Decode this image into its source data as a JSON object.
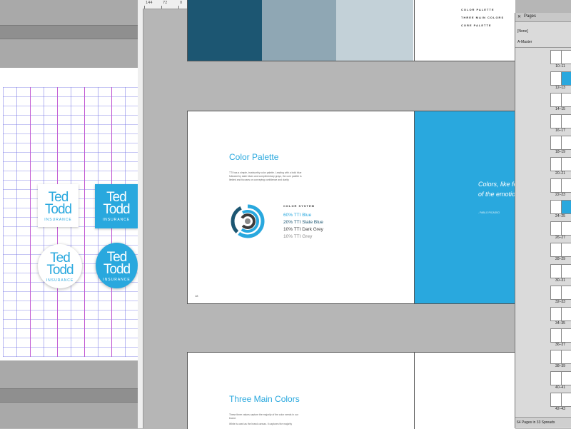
{
  "left_window": {
    "logos": [
      {
        "line1": "Ted",
        "line2": "Todd",
        "sub": "INSURANCE"
      },
      {
        "line1": "Ted",
        "line2": "Todd",
        "sub": "INSURANCE"
      },
      {
        "line1": "Ted",
        "line2": "Todd",
        "sub": "INSURANCE"
      },
      {
        "line1": "Ted",
        "line2": "Todd",
        "sub": "INSURANCE"
      }
    ]
  },
  "ruler": {
    "labels": [
      "144",
      "72",
      "0",
      "72",
      "144",
      "216",
      "288",
      "360",
      "432",
      "504",
      "576",
      "648",
      "720",
      "792",
      "864",
      "936",
      "1008",
      "1080",
      "1152",
      "1224",
      "1296",
      "1368"
    ]
  },
  "spread1": {
    "list": [
      "COLOR PALETTE",
      "THREE MAIN COLORS",
      "CORE PALETTE"
    ]
  },
  "spread2": {
    "title": "Color Palette",
    "body": "TTI has a simple, trustworthy color palette. Leading with a bold blue followed by slate blues and complimentary grays, the core palette is limited and focuses on conveying confidence and clarity.",
    "color_system_label": "COLOR SYSTEM",
    "colors": [
      {
        "label": "60% TTI Blue",
        "hex": "#29a8de"
      },
      {
        "label": "20% TTI Slate Blue",
        "hex": "#1d4f6c"
      },
      {
        "label": "10% TTI Dark Grey",
        "hex": "#3a3a3a"
      },
      {
        "label": "10% TTI Grey",
        "hex": "#8a8a8a"
      }
    ],
    "page_number": "18",
    "quote": "Colors, like fe... of the emotio...",
    "quote_line1": "Colors, like fe",
    "quote_line2": "of the emotio",
    "quote_author": "- PABLO PICASSO"
  },
  "spread3": {
    "title": "Three Main Colors",
    "body1": "These three values capture the majority of the color needs in our brand.",
    "body2": "White is used as the brand canvas. It captures the majority"
  },
  "pages_panel": {
    "title": "Pages",
    "none_label": "[None]",
    "master_label": "A-Master",
    "spreads": [
      "10–11",
      "12–13",
      "14–15",
      "16–17",
      "18–19",
      "20–21",
      "22–23",
      "24–25",
      "26–27",
      "28–29",
      "30–31",
      "32–33",
      "34–35",
      "36–37",
      "38–39",
      "40–41",
      "42–43"
    ],
    "footer": "64 Pages in 33 Spreads"
  },
  "colors": {
    "tti_blue": "#29a8de",
    "slate": "#1c5672",
    "slate_light": "#8fa7b4",
    "slate_lighter": "#c3d1d8"
  }
}
